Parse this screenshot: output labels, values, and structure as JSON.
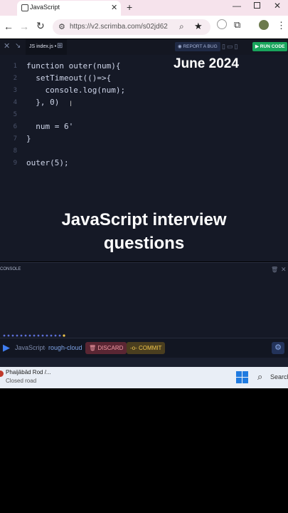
{
  "browser": {
    "tab_title": "JavaScript",
    "tab_close": "✕",
    "new_tab": "+",
    "url": "https://v2.scrimba.com/s02jd62",
    "window_min": "—",
    "window_close": "✕"
  },
  "editor": {
    "file_tab": "JS index.js •",
    "report_bug": "◉ REPORT A BUG",
    "run_code": "▶ RUN CODE",
    "line_numbers": [
      "1",
      "2",
      "3",
      "4",
      "5",
      "6",
      "7",
      "8",
      "9"
    ],
    "code_lines": [
      "function outer(num){",
      "  setTimeout(()=>{",
      "    console.log(num);",
      "  }, 0)",
      "",
      "  num = 6'",
      "}",
      "",
      "outer(5);"
    ]
  },
  "overlay": {
    "date": "June 2024",
    "title": "JavaScript interview questions"
  },
  "console": {
    "label": "CONSOLE"
  },
  "bottom_bar": {
    "language": "JavaScript",
    "separator": "·",
    "scrim_name": "rough-cloud",
    "discard": "🗑 DISCARD",
    "commit": "-o- COMMIT"
  },
  "taskbar": {
    "notification_title": "Phaijābād Rod /...",
    "notification_subtitle": "Closed road",
    "search": "Search"
  },
  "colors": {
    "editor_bg": "#151926",
    "run_green": "#19a55c",
    "discard_bg": "#5a2633",
    "commit_bg": "#4a3e1f"
  }
}
